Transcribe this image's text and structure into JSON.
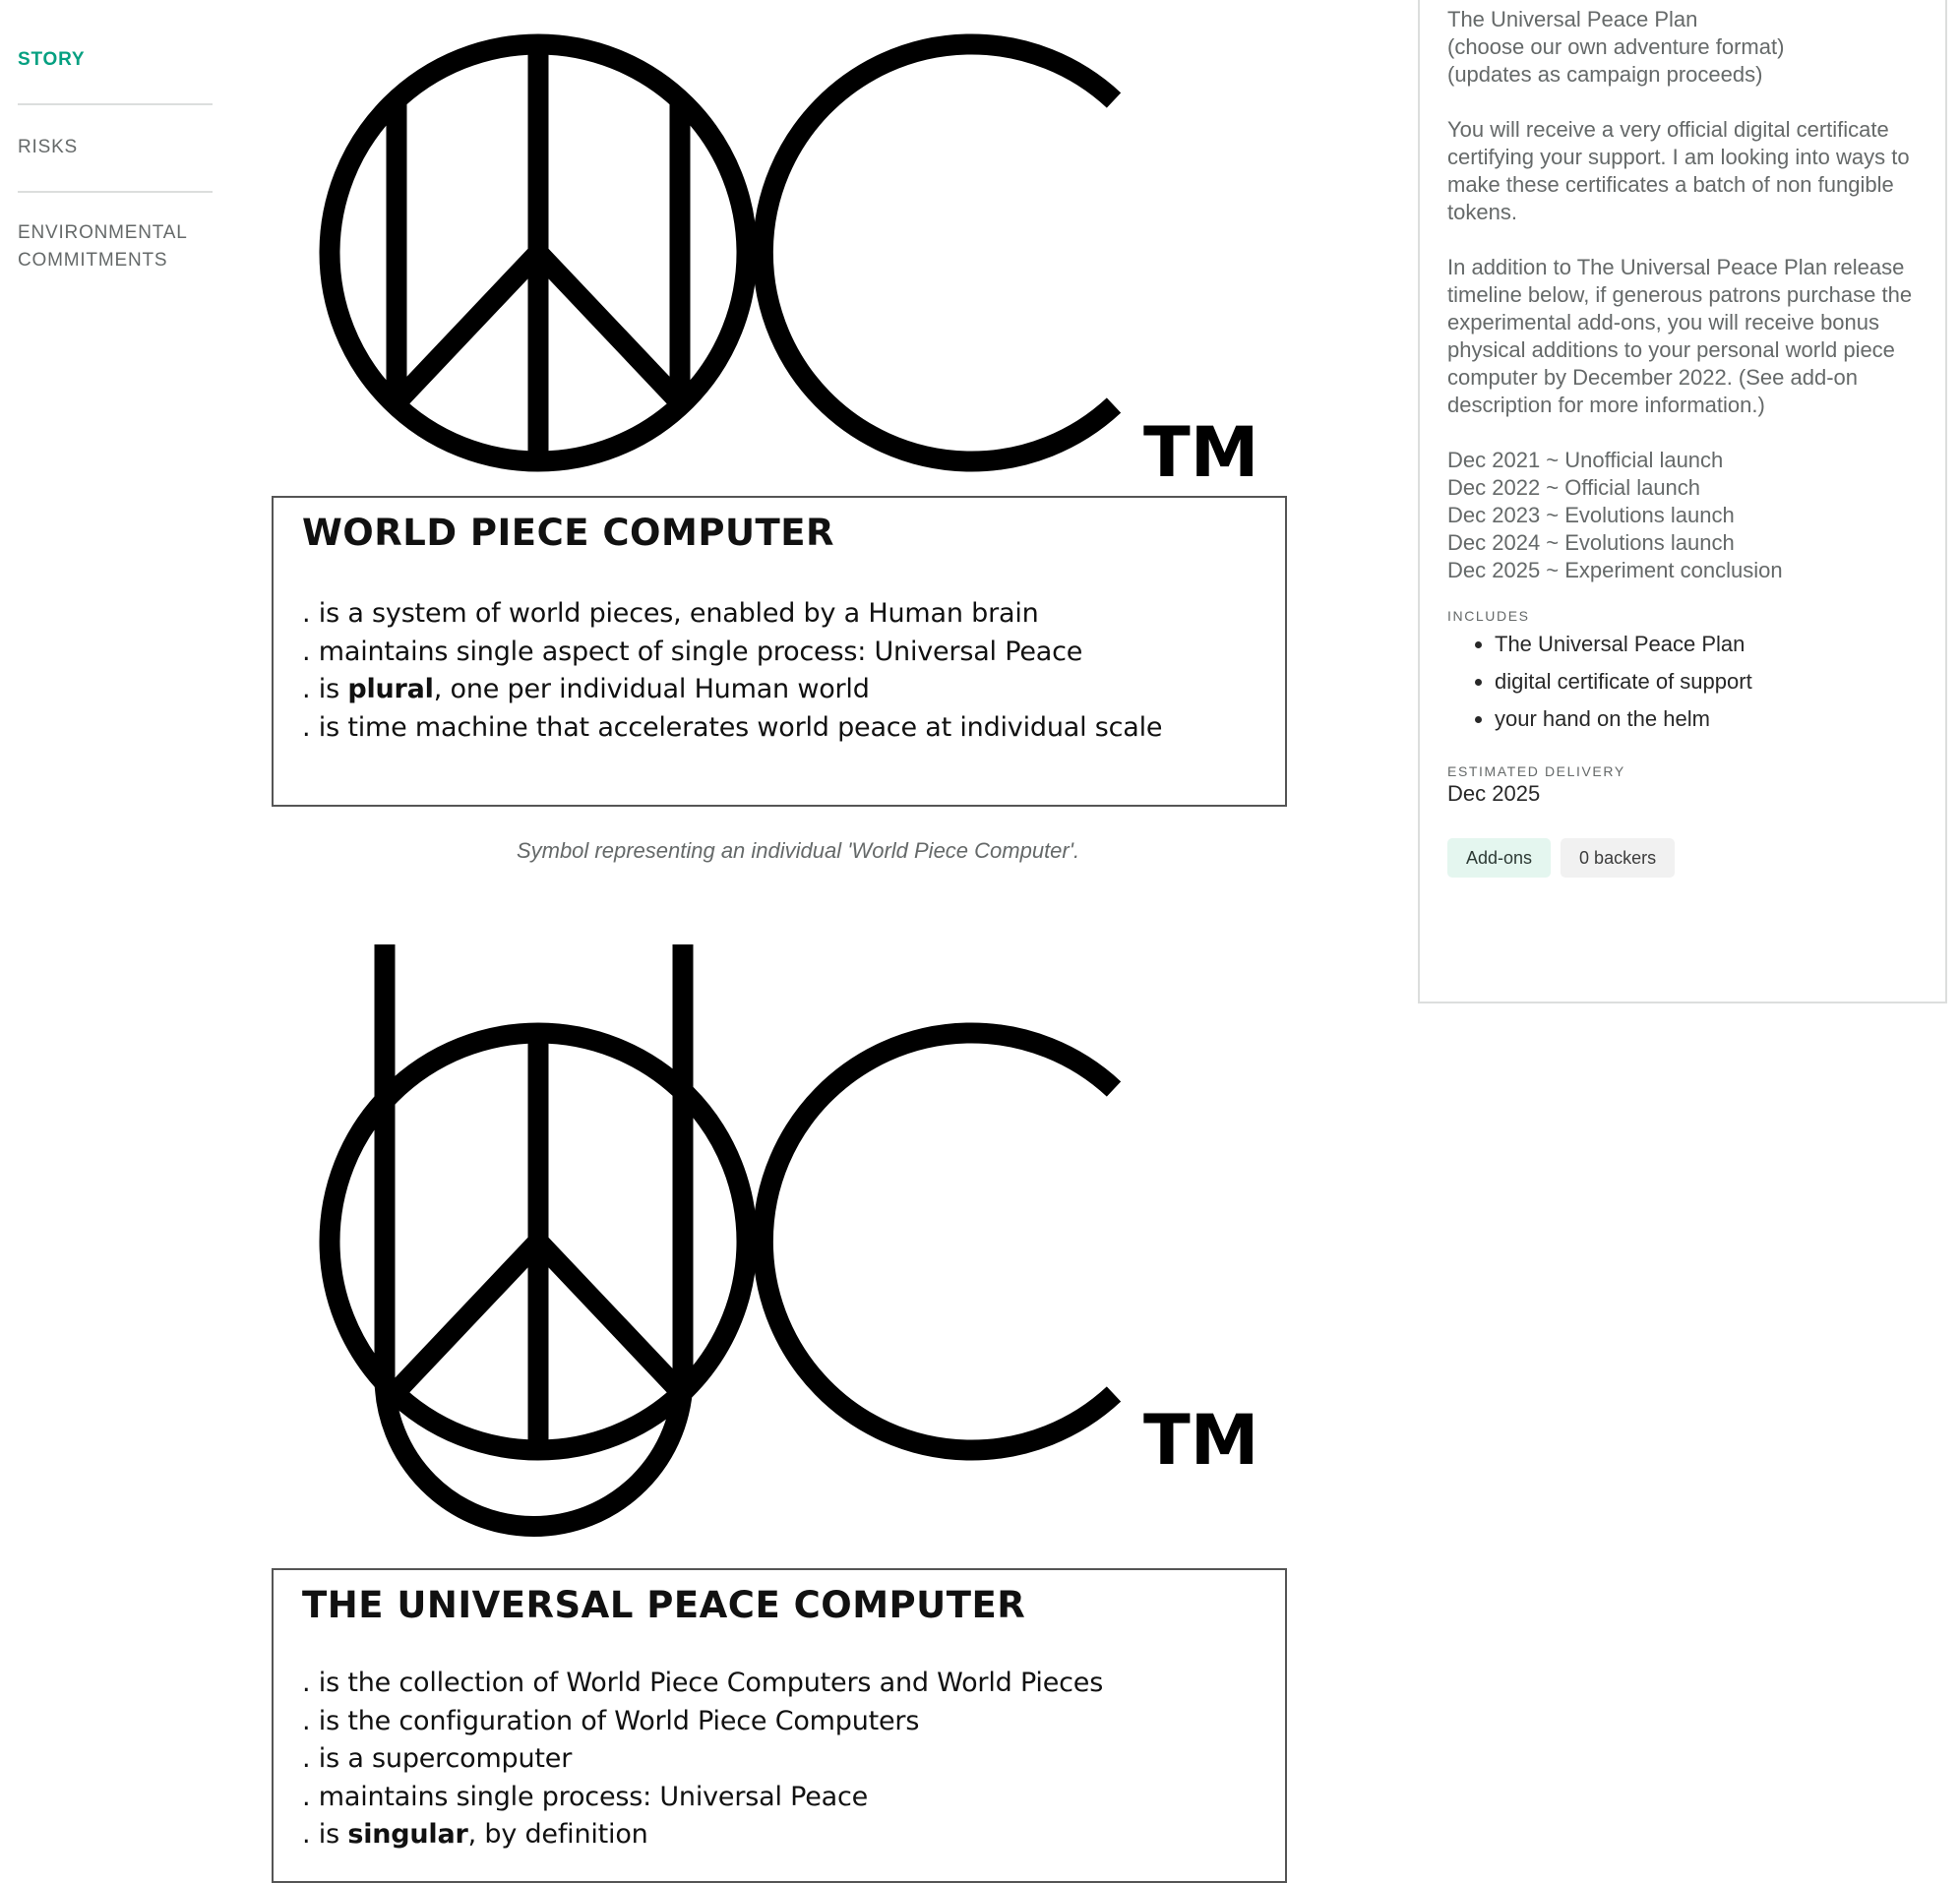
{
  "nav": {
    "story": "STORY",
    "risks": "RISKS",
    "environmental": "ENVIRONMENTAL COMMITMENTS"
  },
  "story": {
    "figure1": {
      "logo_tm": "TM",
      "box_title": "WORLD PIECE COMPUTER",
      "items": [
        {
          "pre": ". is a system of world pieces, enabled by a Human brain",
          "bold": "",
          "post": ""
        },
        {
          "pre": ". maintains single aspect of single process: Universal Peace",
          "bold": "",
          "post": ""
        },
        {
          "pre": ". is ",
          "bold": "plural",
          "post": ", one per individual Human world"
        },
        {
          "pre": ". is time machine that accelerates world peace at individual scale",
          "bold": "",
          "post": ""
        }
      ],
      "caption": "Symbol representing an individual 'World Piece Computer'."
    },
    "figure2": {
      "logo_tm": "TM",
      "box_title": "THE UNIVERSAL PEACE COMPUTER",
      "items": [
        {
          "pre": ". is the collection of World Piece Computers and World Pieces",
          "bold": "",
          "post": ""
        },
        {
          "pre": ". is the configuration of World Piece Computers",
          "bold": "",
          "post": ""
        },
        {
          "pre": ". is a supercomputer",
          "bold": "",
          "post": ""
        },
        {
          "pre": ". maintains single process: Universal Peace",
          "bold": "",
          "post": ""
        },
        {
          "pre": ". is ",
          "bold": "singular",
          "post": ", by definition"
        }
      ]
    }
  },
  "reward": {
    "intro": [
      "The Universal Peace Plan",
      "(choose our own adventure format)",
      "(updates as campaign proceeds)"
    ],
    "certificate": "You will receive a very official digital certificate certifying your support. I am looking into ways to make these certificates a batch of non fungible tokens.",
    "addons_note": "In addition to The Universal Peace Plan release timeline below, if generous patrons purchase the experimental add-ons, you will receive bonus physical additions to your personal world piece computer by December 2022. (See add-on description for more information.)",
    "timeline": [
      "Dec 2021 ~ Unofficial launch",
      "Dec 2022 ~ Official launch",
      "Dec 2023 ~ Evolutions launch",
      "Dec 2024 ~ Evolutions launch",
      "Dec 2025 ~ Experiment conclusion"
    ],
    "includes_label": "INCLUDES",
    "includes": [
      "The Universal Peace Plan",
      "digital certificate of support",
      "your hand on the helm"
    ],
    "delivery_label": "ESTIMATED DELIVERY",
    "delivery_value": "Dec 2025",
    "addons_badge": "Add-ons",
    "backers_badge": "0 backers"
  },
  "colors": {
    "accent": "#05a081",
    "muted_text": "#656969",
    "divider": "#dcdedd"
  }
}
